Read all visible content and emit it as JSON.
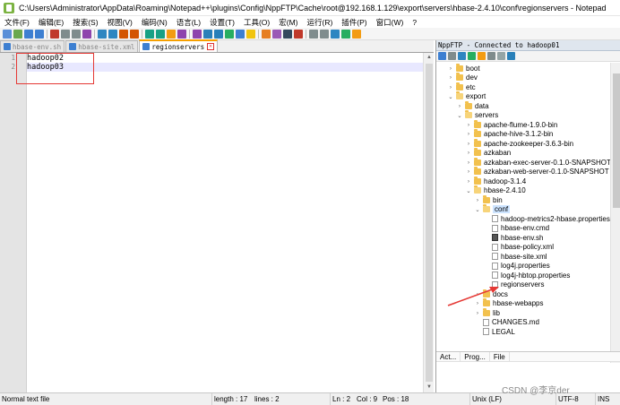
{
  "window": {
    "title": "C:\\Users\\Administrator\\AppData\\Roaming\\Notepad++\\plugins\\Config\\NppFTP\\Cache\\root@192.168.1.129\\export\\servers\\hbase-2.4.10\\conf\\regionservers - Notepad"
  },
  "menu": [
    "文件(F)",
    "编辑(E)",
    "搜索(S)",
    "视图(V)",
    "编码(N)",
    "语言(L)",
    "设置(T)",
    "工具(O)",
    "宏(M)",
    "运行(R)",
    "插件(P)",
    "窗口(W)",
    "?"
  ],
  "tabs": [
    {
      "label": "hbase-env.sh"
    },
    {
      "label": "hbase-site.xml"
    },
    {
      "label": "regionservers"
    }
  ],
  "editor": {
    "lines": [
      "hadoop02",
      "hadoop03"
    ]
  },
  "panel": {
    "title": "NppFTP - Connected to hadoop01",
    "tree": [
      {
        "label": "boot",
        "type": "folder",
        "expanded": false
      },
      {
        "label": "dev",
        "type": "folder",
        "expanded": false
      },
      {
        "label": "etc",
        "type": "folder",
        "expanded": false
      },
      {
        "label": "export",
        "type": "folder",
        "expanded": true
      },
      {
        "label": "data",
        "type": "folder",
        "expanded": false
      },
      {
        "label": "servers",
        "type": "folder",
        "expanded": true
      },
      {
        "label": "apache-flume-1.9.0-bin",
        "type": "folder",
        "expanded": false
      },
      {
        "label": "apache-hive-3.1.2-bin",
        "type": "folder",
        "expanded": false
      },
      {
        "label": "apache-zookeeper-3.6.3-bin",
        "type": "folder",
        "expanded": false
      },
      {
        "label": "azkaban",
        "type": "folder",
        "expanded": false
      },
      {
        "label": "azkaban-exec-server-0.1.0-SNAPSHOT",
        "type": "folder",
        "expanded": false
      },
      {
        "label": "azkaban-web-server-0.1.0-SNAPSHOT",
        "type": "folder",
        "expanded": false
      },
      {
        "label": "hadoop-3.1.4",
        "type": "folder",
        "expanded": false
      },
      {
        "label": "hbase-2.4.10",
        "type": "folder",
        "expanded": true
      },
      {
        "label": "bin",
        "type": "folder",
        "expanded": false
      },
      {
        "label": "conf",
        "type": "folder",
        "expanded": true
      },
      {
        "label": "hadoop-metrics2-hbase.properties",
        "type": "file"
      },
      {
        "label": "hbase-env.cmd",
        "type": "file"
      },
      {
        "label": "hbase-env.sh",
        "type": "file"
      },
      {
        "label": "hbase-policy.xml",
        "type": "file"
      },
      {
        "label": "hbase-site.xml",
        "type": "file"
      },
      {
        "label": "log4j.properties",
        "type": "file"
      },
      {
        "label": "log4j-hbtop.properties",
        "type": "file"
      },
      {
        "label": "regionservers",
        "type": "file"
      },
      {
        "label": "docs",
        "type": "folder",
        "expanded": false
      },
      {
        "label": "hbase-webapps",
        "type": "folder",
        "expanded": false
      },
      {
        "label": "lib",
        "type": "folder",
        "expanded": false
      },
      {
        "label": "CHANGES.md",
        "type": "file"
      },
      {
        "label": "LEGAL",
        "type": "file"
      }
    ],
    "queue_headers": [
      "Act...",
      "Prog...",
      "File"
    ]
  },
  "status": {
    "type": "Normal text file",
    "length": "length : 17",
    "lines": "lines : 2",
    "ln": "Ln : 2",
    "col": "Col : 9",
    "pos": "Pos : 18",
    "eol": "Unix (LF)",
    "encoding": "UTF-8",
    "mode": "INS"
  },
  "watermark": "CSDN @李京der",
  "colors": {
    "annotation_red": "#e53935",
    "tab_active_accent": "#f6a000",
    "folder": "#f2c14e"
  }
}
